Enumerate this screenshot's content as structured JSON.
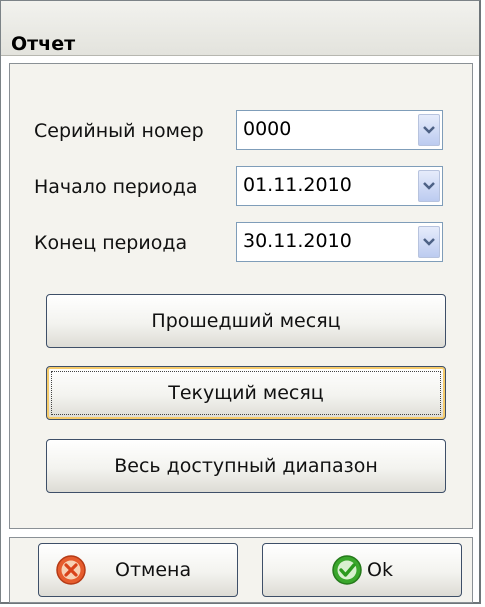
{
  "window": {
    "title": "Отчет"
  },
  "form": {
    "serial": {
      "label": "Серийный номер",
      "value": "0000"
    },
    "start": {
      "label": "Начало периода",
      "value": "01.11.2010"
    },
    "end": {
      "label": "Конец периода",
      "value": "30.11.2010"
    }
  },
  "buttons": {
    "last_month": "Прошедший месяц",
    "current_month": "Текущий месяц",
    "all_range": "Весь доступный диапазон"
  },
  "footer": {
    "cancel": "Отмена",
    "ok": "Ok"
  },
  "icons": {
    "dropdown": "chevron-down-icon",
    "cancel": "cancel-icon",
    "ok": "checkmark-icon"
  },
  "colors": {
    "combo_border": "#7f9db9",
    "button_border": "#3e4f68",
    "focus_ring": "#f5cb6b",
    "cancel_icon": "#e65c2d",
    "ok_icon": "#3aa72c"
  }
}
